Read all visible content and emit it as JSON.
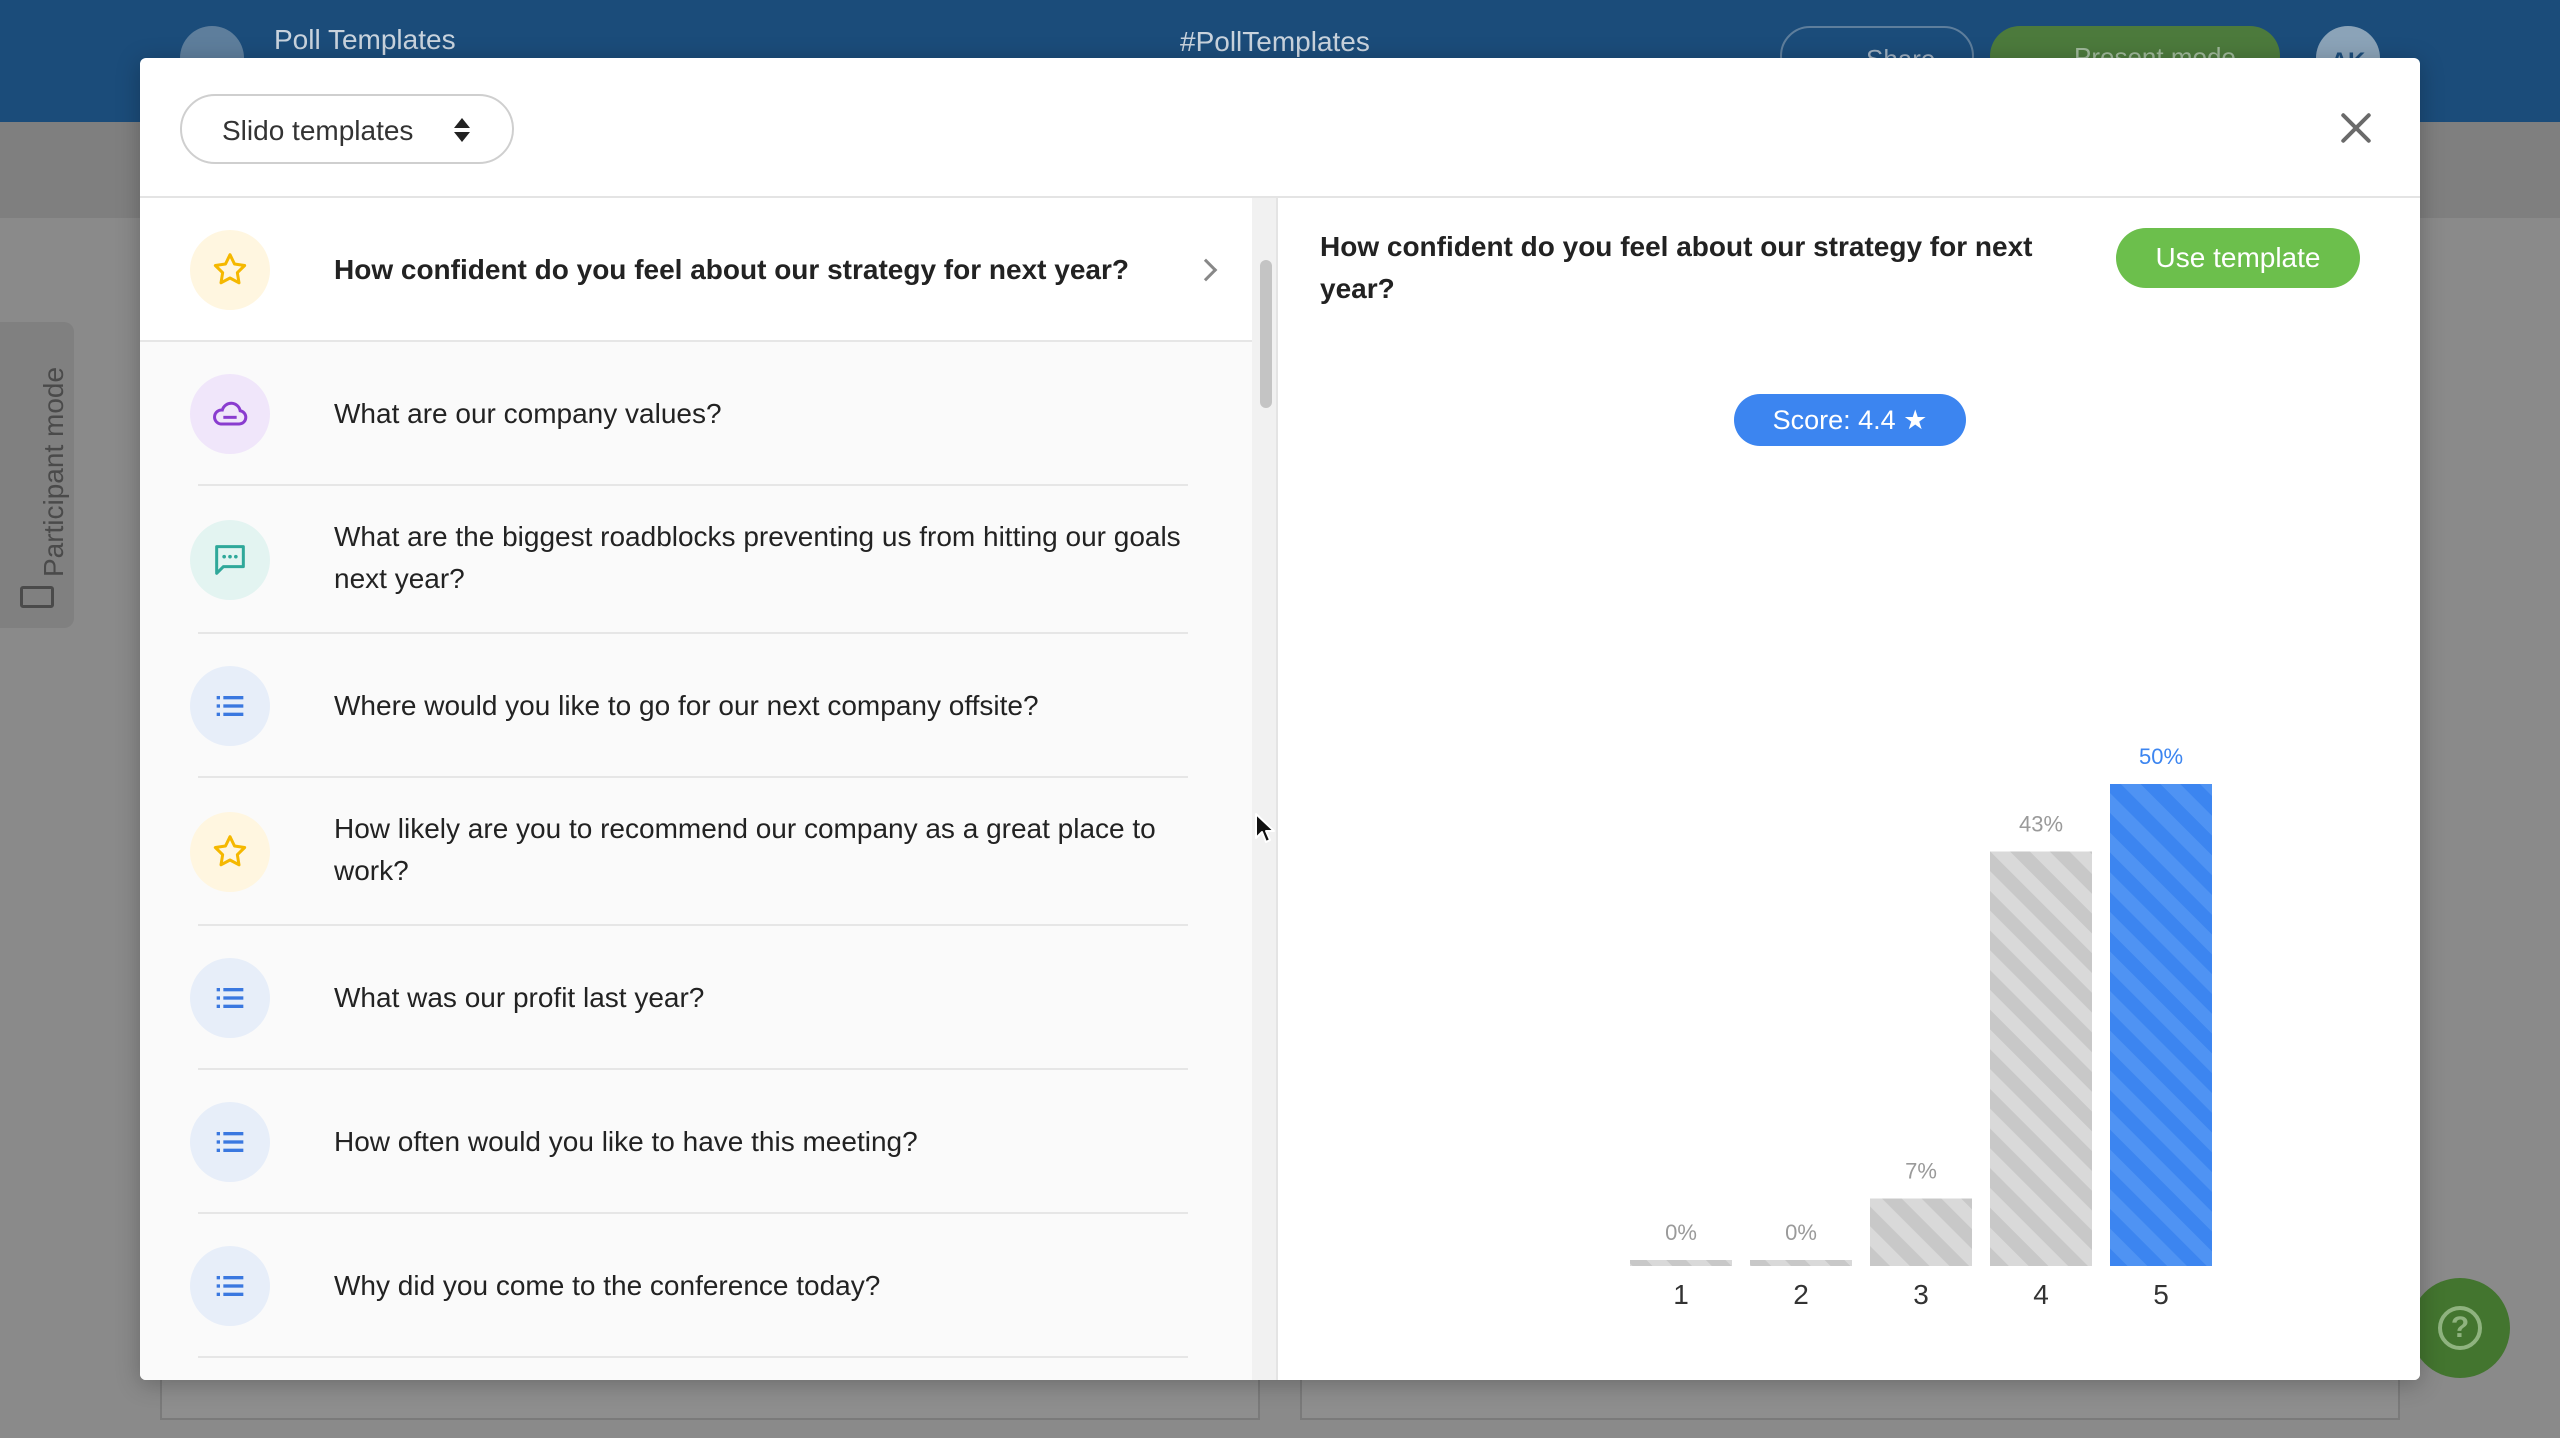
{
  "background_app": {
    "title": "Poll Templates",
    "hashtag": "#PollTemplates",
    "share_label": "Share",
    "present_label": "Present mode",
    "avatar_initials": "AK",
    "participant_mode_label": "Participant mode"
  },
  "modal": {
    "template_source_select": "Slido templates",
    "list": [
      {
        "text": "How confident do you feel about our strategy for next year?",
        "icon": "star-icon",
        "selected": true
      },
      {
        "text": "What are our company values?",
        "icon": "word-cloud-icon",
        "selected": false
      },
      {
        "text": "What are the biggest roadblocks preventing us from hitting our goals next year?",
        "icon": "chat-bubble-icon",
        "selected": false
      },
      {
        "text": "Where would you like to go for our next company offsite?",
        "icon": "list-icon",
        "selected": false
      },
      {
        "text": "How likely are you to recommend our company as a great place to work?",
        "icon": "star-icon",
        "selected": false
      },
      {
        "text": "What was our profit last year?",
        "icon": "list-icon",
        "selected": false
      },
      {
        "text": "How often would you like to have this meeting?",
        "icon": "list-icon",
        "selected": false
      },
      {
        "text": "Why did you come to the conference today?",
        "icon": "list-icon",
        "selected": false
      }
    ],
    "preview": {
      "title": "How confident do you feel about our strategy for next year?",
      "use_template_label": "Use template",
      "score_label": "Score: 4.4 ★"
    }
  },
  "colors": {
    "accent_green": "#6cbf4c",
    "accent_blue": "#3c85f0",
    "bar_gray": "#c8c8c8",
    "topbar": "#1b4c7a"
  },
  "chart_data": {
    "type": "bar",
    "categories": [
      "1",
      "2",
      "3",
      "4",
      "5"
    ],
    "values": [
      0,
      0,
      7,
      43,
      50
    ],
    "value_labels": [
      "0%",
      "0%",
      "7%",
      "43%",
      "50%"
    ],
    "highlight_index": 4,
    "ylim": [
      0,
      50
    ],
    "grid": false
  }
}
